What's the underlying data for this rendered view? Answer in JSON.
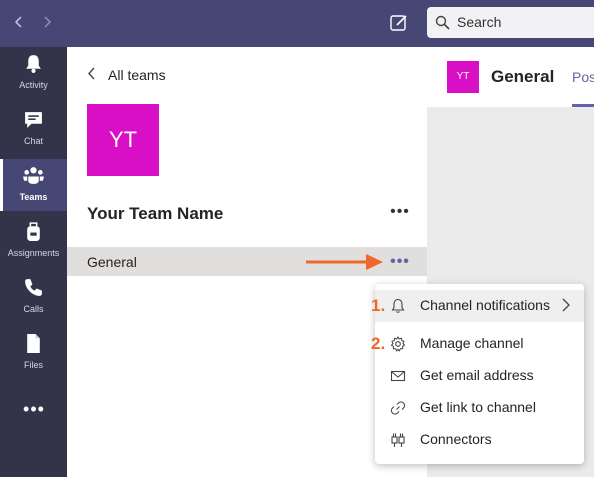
{
  "colors": {
    "accent": "#6264a7",
    "topbar": "#464775",
    "rail": "#33344a",
    "team_avatar": "#d80fc5",
    "annotation": "#f0662b"
  },
  "topbar": {
    "back_icon": "chevron-left-icon",
    "forward_icon": "chevron-right-icon",
    "compose_icon": "compose-icon",
    "search_placeholder": "Search"
  },
  "rail": {
    "items": [
      {
        "label": "Activity",
        "icon": "bell-icon"
      },
      {
        "label": "Chat",
        "icon": "chat-icon"
      },
      {
        "label": "Teams",
        "icon": "teams-icon",
        "active": true
      },
      {
        "label": "Assignments",
        "icon": "backpack-icon"
      },
      {
        "label": "Calls",
        "icon": "phone-icon"
      },
      {
        "label": "Files",
        "icon": "file-icon"
      }
    ],
    "more": "•••"
  },
  "panel": {
    "back_label": "All teams",
    "team_avatar": "YT",
    "team_name": "Your Team Name",
    "team_more": "•••",
    "channel_name": "General",
    "channel_more": "•••"
  },
  "content": {
    "avatar": "YT",
    "title": "General",
    "tab": "Posts"
  },
  "menu": {
    "items": [
      {
        "label": "Channel notifications",
        "icon": "bell-icon",
        "has_submenu": true
      },
      {
        "label": "Manage channel",
        "icon": "gear-icon"
      },
      {
        "label": "Get email address",
        "icon": "email-icon"
      },
      {
        "label": "Get link to channel",
        "icon": "link-icon"
      },
      {
        "label": "Connectors",
        "icon": "connectors-icon"
      }
    ]
  },
  "annotations": {
    "step1": "1.",
    "step2": "2."
  }
}
